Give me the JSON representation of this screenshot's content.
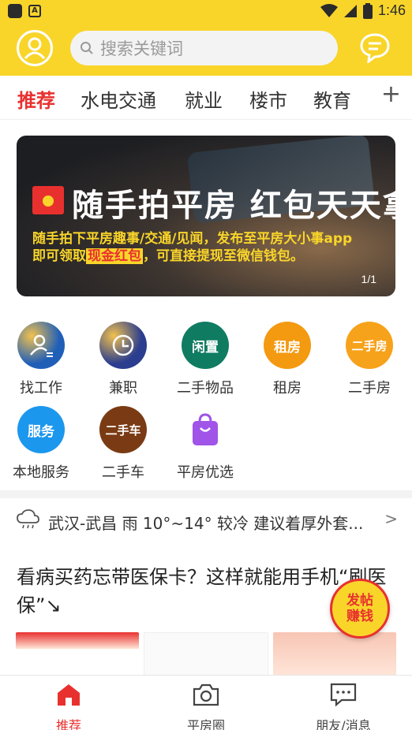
{
  "status_bar": {
    "time": "1:46"
  },
  "header": {
    "search_placeholder": "搜索关键词"
  },
  "tabs": [
    "推荐",
    "水电交通",
    "就业",
    "楼市",
    "教育"
  ],
  "banner": {
    "title": "随手拍平房 红包天天拿",
    "line1": "随手拍下平房趣事/交通/见闻，发布至平房大小事app",
    "line2_prefix": "即可领取",
    "line2_highlight": "现金红包",
    "line2_suffix": "，可直接提现至微信钱包。",
    "page": "1/1"
  },
  "grid": [
    {
      "label": "找工作",
      "badge": "",
      "color": "#1f5fb8",
      "icon": "job-icon"
    },
    {
      "label": "兼职",
      "badge": "",
      "color": "#2a3d8f",
      "icon": "clock-icon"
    },
    {
      "label": "二手物品",
      "badge": "闲置",
      "color": "#0f7c62",
      "icon": "idle-badge-icon"
    },
    {
      "label": "租房",
      "badge": "租房",
      "color": "#f39a11",
      "icon": "rent-badge-icon"
    },
    {
      "label": "二手房",
      "badge": "二手房",
      "color": "#f7a21b",
      "icon": "second-house-badge-icon"
    },
    {
      "label": "本地服务",
      "badge": "服务",
      "color": "#1c97ee",
      "icon": "service-badge-icon"
    },
    {
      "label": "二手车",
      "badge": "二手车",
      "color": "#7a3b14",
      "icon": "used-car-badge-icon"
    },
    {
      "label": "平房优选",
      "badge": "",
      "color": "#a054e8",
      "icon": "shopping-bag-icon"
    }
  ],
  "weather": {
    "text": "武汉-武昌 雨 10°~14° 较冷 建议着厚外套...",
    "icon": "cloud-rain-icon"
  },
  "article": {
    "title": "看病买药忘带医保卡？这样就能用手机“刷医保”↘"
  },
  "fab": {
    "line1": "发帖",
    "line2": "赚钱"
  },
  "bottom_nav": [
    {
      "label": "推荐",
      "icon": "home-icon"
    },
    {
      "label": "平房圈",
      "icon": "camera-icon"
    },
    {
      "label": "朋友/消息",
      "icon": "chat-icon"
    }
  ],
  "colors": {
    "brand_yellow": "#f9d52a",
    "accent_red": "#e8312f"
  }
}
